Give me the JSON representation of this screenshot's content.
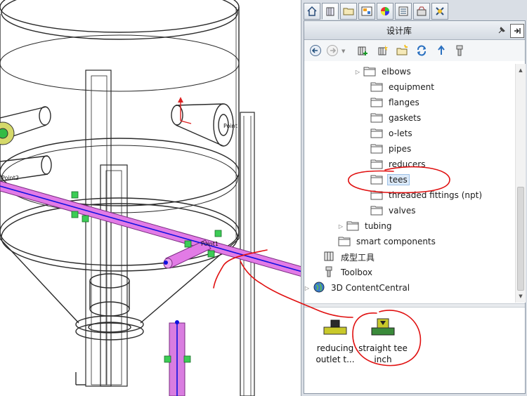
{
  "taskpane": {
    "tabs": [
      {
        "icon": "home-icon"
      },
      {
        "icon": "design-library-icon",
        "active": true
      },
      {
        "icon": "file-explorer-icon"
      },
      {
        "icon": "view-palette-icon"
      },
      {
        "icon": "appearances-icon"
      },
      {
        "icon": "custom-properties-icon"
      },
      {
        "icon": "routing-library-icon"
      },
      {
        "icon": "toolbox-icon"
      }
    ],
    "title": "设计库",
    "header_buttons": [
      {
        "icon": "pin-icon"
      },
      {
        "icon": "collapse-panel-icon"
      }
    ],
    "toolbar": [
      {
        "icon": "back-arrow-icon"
      },
      {
        "icon": "forward-arrow-icon"
      },
      {
        "icon": "add-to-library-icon"
      },
      {
        "icon": "add-file-location-icon"
      },
      {
        "icon": "create-new-folder-icon"
      },
      {
        "icon": "refresh-icon"
      },
      {
        "icon": "up-one-level-icon"
      },
      {
        "icon": "toolbox-settings-icon"
      }
    ]
  },
  "tree": [
    {
      "label": "elbows",
      "expander": "collapsed"
    },
    {
      "label": "equipment"
    },
    {
      "label": "flanges"
    },
    {
      "label": "gaskets"
    },
    {
      "label": "o-lets"
    },
    {
      "label": "pipes"
    },
    {
      "label": "reducers"
    },
    {
      "label": "tees",
      "selected": true
    },
    {
      "label": "threaded fittings (npt)"
    },
    {
      "label": "valves"
    },
    {
      "label": "tubing",
      "expander": "collapsed"
    },
    {
      "label": "smart components"
    },
    {
      "label": "成型工具"
    },
    {
      "label": "Toolbox"
    },
    {
      "label": "3D ContentCentral",
      "expander": "collapsed"
    }
  ],
  "components": [
    {
      "line1": "reducing",
      "line2": "outlet t...",
      "icon": "reducing-outlet-tee-icon"
    },
    {
      "line1": "straight tee",
      "line2": "inch",
      "icon": "straight-tee-icon"
    }
  ],
  "viewport": {
    "labels": {
      "point1": "Point1",
      "point2": "Point2",
      "pt": "Point"
    }
  },
  "colors": {
    "pipe": "#e27be6",
    "axis": "#1010e0",
    "annotation": "#e01010",
    "selection": "#dbe9f8"
  }
}
